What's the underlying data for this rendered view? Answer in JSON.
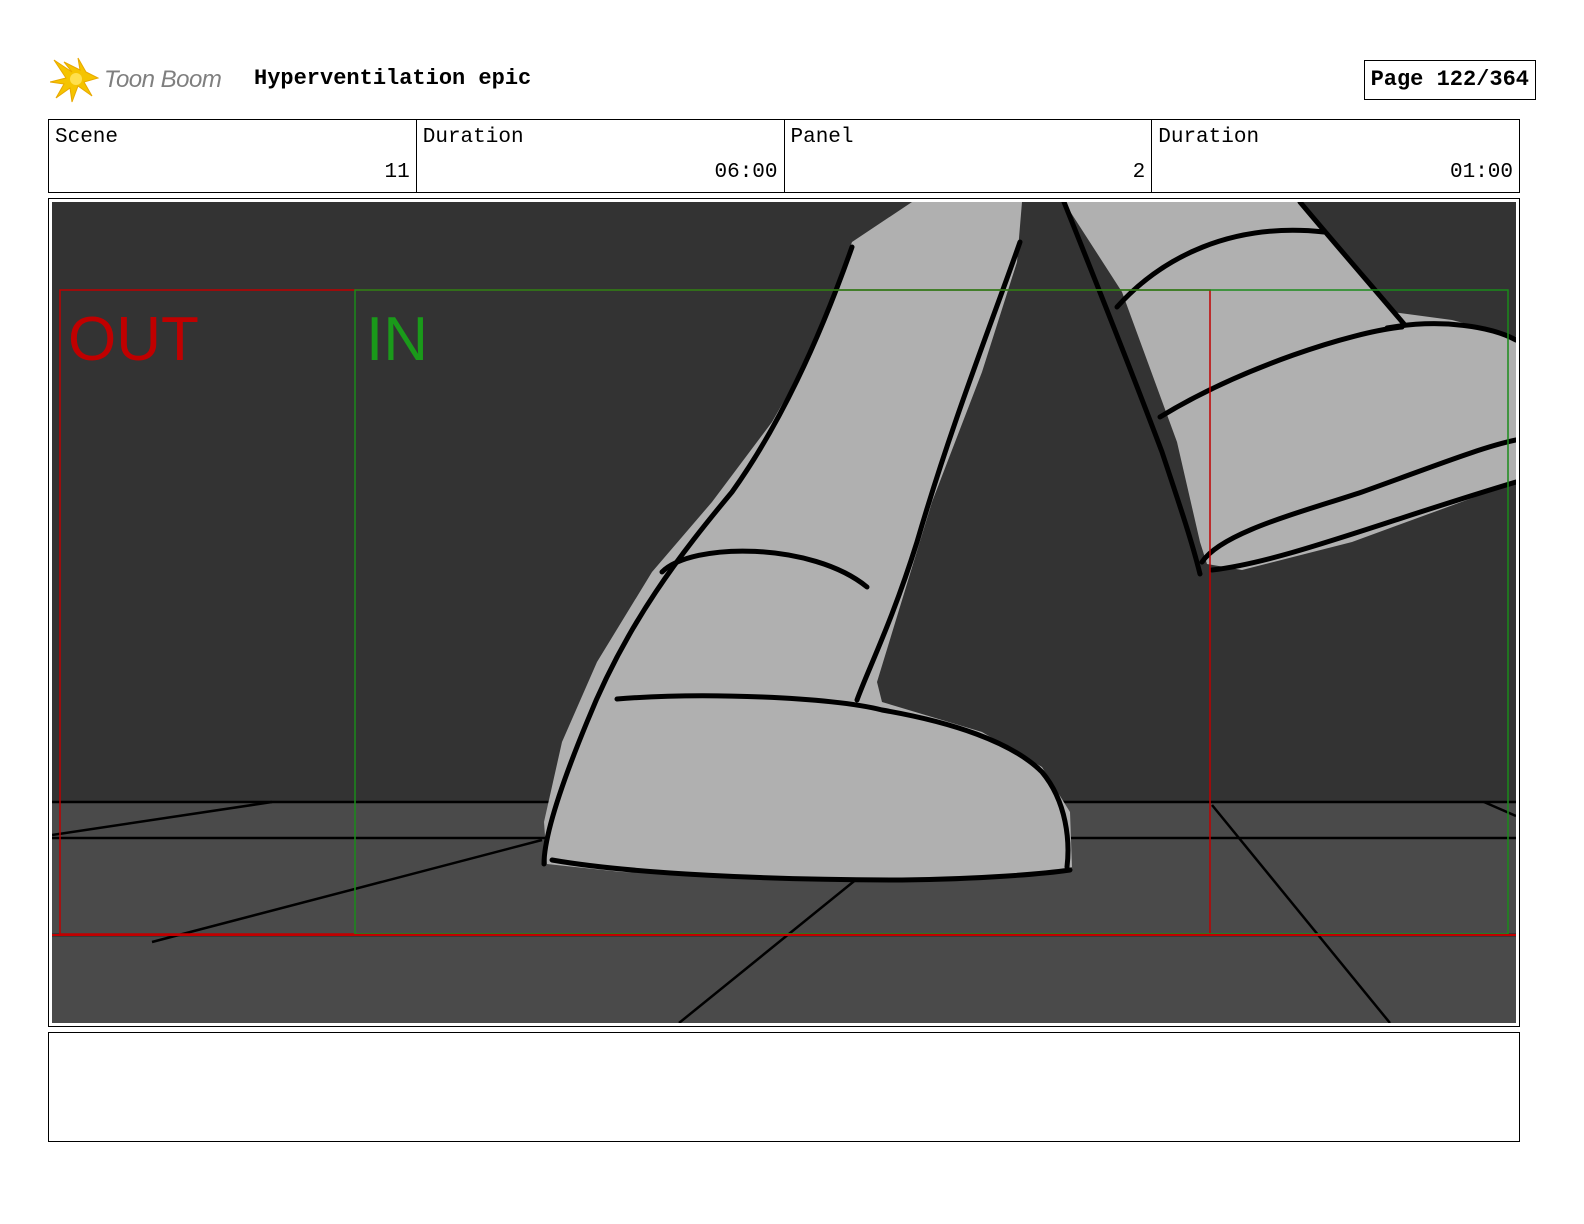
{
  "header": {
    "logo_text": "Toon Boom",
    "project_title": "Hyperventilation epic",
    "page_label": "Page 122/364"
  },
  "info": [
    {
      "label": "Scene",
      "value": "11"
    },
    {
      "label": "Duration",
      "value": "06:00"
    },
    {
      "label": "Panel",
      "value": "2"
    },
    {
      "label": "Duration",
      "value": "01:00"
    }
  ],
  "panel": {
    "out_label": "OUT",
    "in_label": "IN",
    "colors": {
      "wall": "#333333",
      "floor": "#4a4a4a",
      "boot": "#b0b0b0",
      "out_frame": "#c00000",
      "in_frame": "#1a8a1a"
    }
  },
  "notes": {
    "text": ""
  }
}
